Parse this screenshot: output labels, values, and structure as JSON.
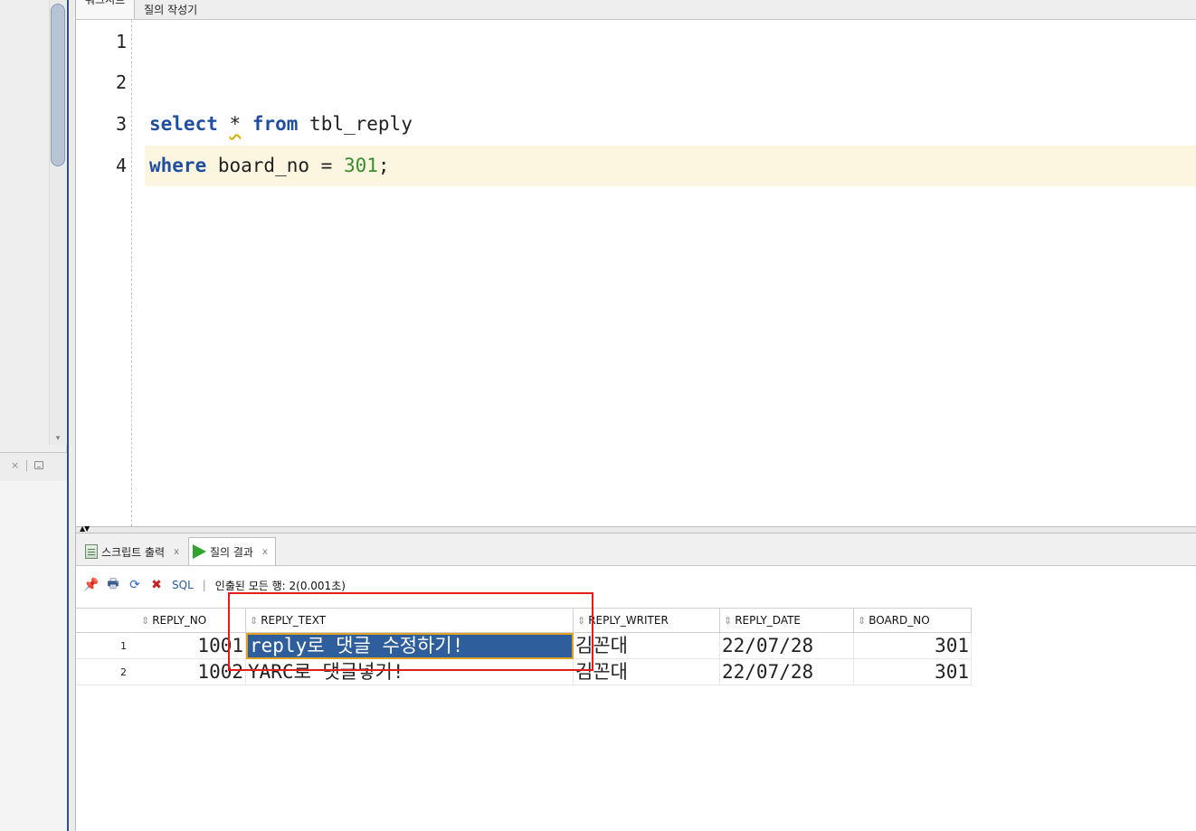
{
  "top_tabs": [
    "워크시트",
    "질의 작성기"
  ],
  "editor": {
    "lines": [
      {
        "num": "1",
        "parts": []
      },
      {
        "num": "2",
        "parts": []
      },
      {
        "num": "3",
        "parts": [
          {
            "text": "select",
            "style": "kw"
          },
          {
            "text": " ",
            "style": ""
          },
          {
            "text": "*",
            "style": "star"
          },
          {
            "text": " ",
            "style": ""
          },
          {
            "text": "from",
            "style": "kw"
          },
          {
            "text": " tbl_reply",
            "style": ""
          }
        ]
      },
      {
        "num": "4",
        "parts": [
          {
            "text": "where",
            "style": "kw"
          },
          {
            "text": " board_no = ",
            "style": ""
          },
          {
            "text": "301",
            "style": "num"
          },
          {
            "text": ";",
            "style": ""
          }
        ]
      }
    ]
  },
  "result_tabs": [
    {
      "label": "스크립트 출력",
      "close": "x",
      "icon": "script-output-icon"
    },
    {
      "label": "질의 결과",
      "close": "x",
      "icon": "run-query-icon"
    }
  ],
  "toolbar": {
    "sql_label": "SQL",
    "separator": "|",
    "status": "인출된 모든 행: 2(0.001초)"
  },
  "grid": {
    "columns": [
      "REPLY_NO",
      "REPLY_TEXT",
      "REPLY_WRITER",
      "REPLY_DATE",
      "BOARD_NO"
    ],
    "rows": [
      {
        "row": "1",
        "cells": [
          "1001",
          "reply로 댓글 수정하기!",
          "김꼰대",
          "22/07/28",
          "301"
        ]
      },
      {
        "row": "2",
        "cells": [
          "1002",
          "YARC로 댓글넣기!",
          "김꼰대",
          "22/07/28",
          "301"
        ]
      }
    ]
  },
  "colors": {
    "keyword": "#1f4f9e",
    "number": "#3b8c2f",
    "current_line": "#fcf5e0",
    "selection": "#2f5e9c",
    "annotation_box": "#e51c1c"
  }
}
